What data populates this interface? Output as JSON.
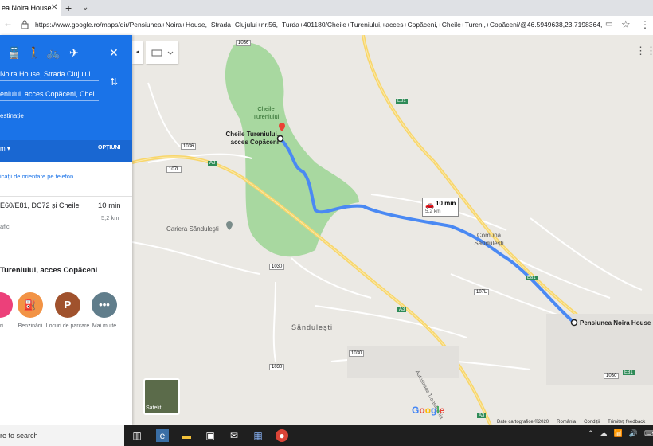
{
  "browser": {
    "tab_title": "ea Noira House",
    "tab_close": "✕",
    "new_tab": "+",
    "tab_list": "⌄",
    "back": "←",
    "url": "https://www.google.ro/maps/dir/Pensiunea+Noira+House,+Strada+Clujului+nr.56,+Turda+401180/Cheile+Tureniului,+acces+Copăceni,+Cheile+Tureni,+Copăceni/@46.5949638,23.7198364,14z/data",
    "reader": "▭",
    "star": "☆",
    "more": "⋮"
  },
  "panel": {
    "modes": [
      "🚆",
      "🚶",
      "🚲",
      "✈"
    ],
    "close": "✕",
    "origin": "Noira House, Strada Clujului",
    "destination": "eniului, acces Copăceni, Chei",
    "swap": "⇅",
    "add_destination": "estinație",
    "depart": "m ▾",
    "options": "OPȚIUNI",
    "send_to_phone": "icații de orientare pe telefon",
    "route": {
      "name": "E60/E81, DC72 și Cheile",
      "time": "10 min",
      "distance": "5,2 km",
      "traffic": "afic"
    },
    "nearby_title": " Tureniului, acces Copăceni",
    "categories": [
      {
        "label": "uri",
        "icon": "",
        "color": "#ec407a"
      },
      {
        "label": "Benzinării",
        "icon": "⛽",
        "color": "#f29345"
      },
      {
        "label": "Locuri de parcare",
        "icon": "P",
        "color": "#a0522d"
      },
      {
        "label": "Mai multe",
        "icon": "•••",
        "color": "#607d8b"
      }
    ]
  },
  "map": {
    "labels": {
      "cheile_tureniului": "Cheile Tureniului",
      "dest_marker": "Cheile Tureniului, acces Copăceni",
      "cariera": "Cariera Sănduleşti",
      "comuna": "Comuna Sănduleşti",
      "sandulesti": "Sănduleşti",
      "origin_marker": "Pensiunea Noira House",
      "autostrada": "Autostrada Transilvania"
    },
    "road_shields": [
      "1036",
      "E81",
      "1036",
      "107L",
      "A3",
      "1030",
      "A3",
      "1030",
      "E81",
      "107L",
      "E81",
      "1030",
      "1030",
      "A3"
    ],
    "route_info": {
      "time": "10 min",
      "distance": "5,2 km"
    },
    "satellite": "Satelit",
    "google": [
      "G",
      "o",
      "o",
      "g",
      "l",
      "e"
    ],
    "google_colors": [
      "#4285f4",
      "#ea4335",
      "#fbbc05",
      "#4285f4",
      "#34a853",
      "#ea4335"
    ],
    "footer": [
      "Date cartografice ©2020",
      "România",
      "Condiții",
      "Trimiteți feedback"
    ],
    "collapse": "◂",
    "apps": "⋮⋮⋮"
  },
  "taskbar": {
    "search": "re to search",
    "tray": [
      "⌃",
      "☁",
      "📶",
      "🔊",
      "⌨"
    ]
  },
  "colors": {
    "route": "#4a89f3",
    "panel_blue": "#1a73e8",
    "park": "#a8d8a0",
    "highway": "#f8d66b"
  }
}
